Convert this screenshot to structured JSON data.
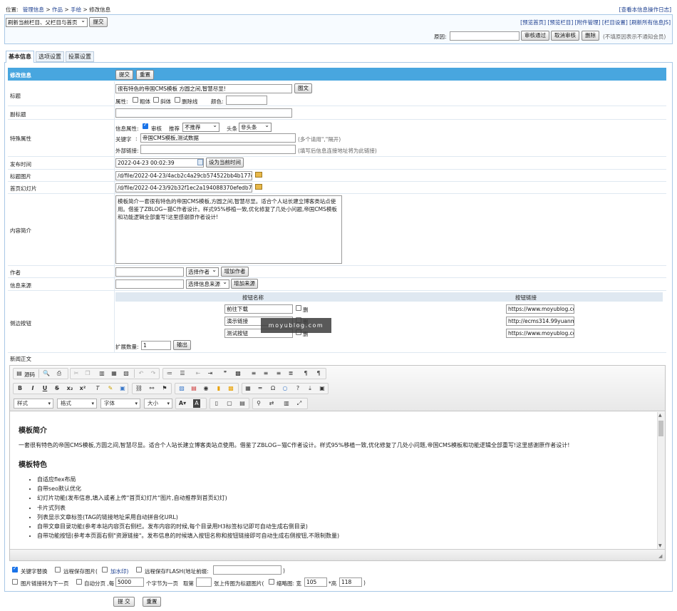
{
  "breadcrumb": {
    "prefix": "位置:",
    "items": [
      "管理信息",
      "作品",
      "手绘",
      "修改信息"
    ],
    "sep": ">"
  },
  "top_right_link": "[查看本信息操作日志]",
  "refresh_select": "刷新当前栏目、父栏目与首页",
  "submit_label": "提交",
  "preview_links": [
    "[预览首页]",
    "[预览栏目]",
    "[附件管理]",
    "[栏目设置]",
    "[刷新所有信息JS]"
  ],
  "review": {
    "reason_label": "原因:",
    "approve": "审核通过",
    "cancel": "取消审核",
    "delete": "删除",
    "note": "(不填原因表示不通知会员)"
  },
  "tabs": [
    "基本信息",
    "选项设置",
    "投票设置"
  ],
  "form": {
    "header": "修改信息",
    "submit": "提交",
    "reset": "重置",
    "title_label": "标题",
    "title_value": "很有特色的帝国CMS模板 方圆之间,智慧尽显!",
    "title_img_btn": "图文",
    "attr_label": "属性:",
    "bold": "粗体",
    "italic": "斜体",
    "strike": "删除线",
    "color_label": "颜色:",
    "subtitle_label": "副标题",
    "special_label": "特殊属性",
    "info_attr": "信息属性:",
    "audit": "审核",
    "recommend": "推荐",
    "recommend_value": "不推荐",
    "headline": "头条",
    "headline_value": "非头条",
    "keywords_label": "关键字",
    "keywords_value": "帝国CMS模板,测试数据",
    "keywords_hint": "(多个请用\",\"隔开)",
    "extlink_label": "外部链接:",
    "extlink_hint": "(填写后信息连接地址将为此链接)",
    "pubtime_label": "发布时间",
    "pubtime_value": "2022-04-23 00:02:39",
    "pubtime_btn": "设为当前时间",
    "titlepic_label": "标题图片",
    "titlepic_value": "/d/file/2022-04-23/4acb2c4a29cb574522bb4b177dad57",
    "slide_label": "首页幻灯片",
    "slide_value": "/d/file/2022-04-23/92b32f1ec2a194088370efedb76301",
    "intro_label": "内容简介",
    "intro_value": "模板简介一套很有特色的帝国CMS模板,方圆之间,智慧尽显。适合个人站长建立博客类站点使用。借鉴了ZBLOG~猫C作者设计。样式95%移植一致,优化修复了几处小问题,帝国CMS模板和功能逻辑全部重写!这里感谢原作者设计!",
    "author_label": "作者",
    "author_select": "选择作者",
    "author_add": "增加作者",
    "source_label": "信息来源",
    "source_select": "选择信息来源",
    "source_add": "增加来源",
    "sidebtn_label": "侧边按钮",
    "col_name": "按钮名称",
    "col_link": "按钮链接",
    "side_buttons": [
      {
        "name": "前往下载",
        "del": "删",
        "link": "https://www.moyublog.con"
      },
      {
        "name": "演示链接",
        "del": "删",
        "link": "http://ecms314.99yuanma."
      },
      {
        "name": "测试按钮",
        "del": "删",
        "link": "https://www.moyublog.con"
      }
    ],
    "expand_label": "扩展数量:",
    "expand_value": "1",
    "expand_btn": "输出",
    "watermark": "moyublog.com",
    "news_label": "新闻正文"
  },
  "editor": {
    "source": "源码",
    "combos": [
      "样式",
      "格式",
      "字体",
      "大小"
    ],
    "h1": "模板简介",
    "p1": "一套很有特色的帝国CMS模板,方圆之间,智慧尽显。适合个人站长建立博客类站点使用。借鉴了ZBLOG~猫C作者设计。样式95%移植一致,优化修复了几处小问题,帝国CMS模板和功能逻辑全部重写!这里感谢原作者设计!",
    "h2": "模板特色",
    "features": [
      "自适应flex布局",
      "自带seo默认优化",
      "幻灯片功能(发布信息,填入或者上传\"首页幻灯片\"图片,自动推荐到首页幻灯)",
      "卡片式列表",
      "列表显示文章标签(TAG的链接地址采用自动拼音化URL)",
      "自带文章目录功能(参考本站内容页右侧栏。发布内容的时候,每个目录用H3标签标记即可自动生成右侧目录)",
      "自带功能按钮(参考本页面右侧\"资源链接\"。发布信息的时候填入按钮名称和按钮链接即可自动生成右侧按钮,不限制数量)"
    ]
  },
  "options": {
    "kw_replace": "关键字替换",
    "save_remote": "远程保存图片(",
    "watermark_link": "加水印)",
    "save_flash": "远程保存FLASH(地址前缀:",
    "close_paren": ")",
    "pic_next": "图片链接转为下一页",
    "auto_page": "自动分页 ,每",
    "page_chars": "5000",
    "chars_per": "个字节为一页",
    "take": "取第",
    "pic_first": "张上传图为标题图片(",
    "thumb": "缩略图: 宽",
    "thumb_w": "105",
    "thumb_h_label": "*高",
    "thumb_h": "118"
  },
  "bottom": {
    "submit": "提 交",
    "reset": "重置"
  }
}
